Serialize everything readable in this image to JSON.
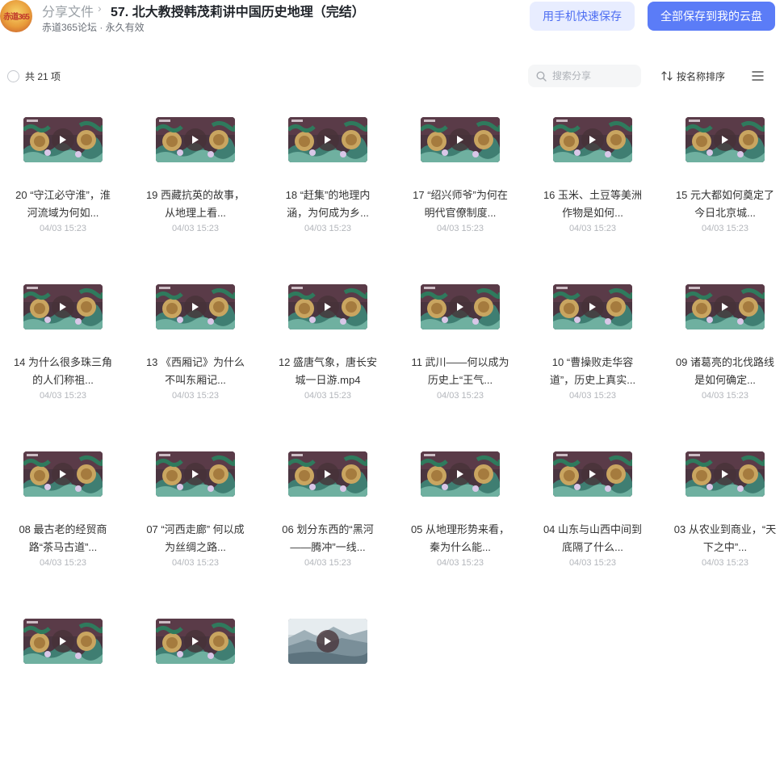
{
  "share": {
    "avatar_text": "赤道365",
    "breadcrumb_root": "分享文件",
    "breadcrumb_sep": "›",
    "title": "57. 北大教授韩茂莉讲中国历史地理（完结）",
    "sub_info": "赤道365论坛 · 永久有效"
  },
  "actions": {
    "phone_save": "用手机快速保存",
    "save_all": "全部保存到我的云盘"
  },
  "toolbar": {
    "item_count": "共 21 项",
    "search_placeholder": "搜索分享",
    "sort_label": "按名称排序"
  },
  "thumbnail_icon": "play-icon",
  "files": [
    {
      "name": "20 “守江必守淮”，淮河流域为何如...",
      "date": "04/03 15:23",
      "thumb": "art"
    },
    {
      "name": "19 西藏抗英的故事，从地理上看...",
      "date": "04/03 15:23",
      "thumb": "art"
    },
    {
      "name": "18 “赶集”的地理内涵，为何成为乡...",
      "date": "04/03 15:23",
      "thumb": "art"
    },
    {
      "name": "17 “绍兴师爷”为何在明代官僚制度...",
      "date": "04/03 15:23",
      "thumb": "art"
    },
    {
      "name": "16 玉米、土豆等美洲作物是如何...",
      "date": "04/03 15:23",
      "thumb": "art"
    },
    {
      "name": "15 元大都如何奠定了今日北京城...",
      "date": "04/03 15:23",
      "thumb": "art"
    },
    {
      "name": "14 为什么很多珠三角的人们称祖...",
      "date": "04/03 15:23",
      "thumb": "art"
    },
    {
      "name": "13 《西厢记》为什么不叫东厢记...",
      "date": "04/03 15:23",
      "thumb": "art"
    },
    {
      "name": "12 盛唐气象，唐长安城一日游.mp4",
      "date": "04/03 15:23",
      "thumb": "art"
    },
    {
      "name": "11 武川——何以成为历史上“王气...",
      "date": "04/03 15:23",
      "thumb": "art"
    },
    {
      "name": "10 “曹操败走华容道”，历史上真实...",
      "date": "04/03 15:23",
      "thumb": "art"
    },
    {
      "name": "09 诸葛亮的北伐路线是如何确定...",
      "date": "04/03 15:23",
      "thumb": "art"
    },
    {
      "name": "08 最古老的经贸商路“茶马古道”...",
      "date": "04/03 15:23",
      "thumb": "art"
    },
    {
      "name": "07 “河西走廊” 何以成为丝绸之路...",
      "date": "04/03 15:23",
      "thumb": "art"
    },
    {
      "name": "06 划分东西的“黑河——腾冲”一线...",
      "date": "04/03 15:23",
      "thumb": "art"
    },
    {
      "name": "05 从地理形势来看，秦为什么能...",
      "date": "04/03 15:23",
      "thumb": "art"
    },
    {
      "name": "04 山东与山西中间到底隔了什么...",
      "date": "04/03 15:23",
      "thumb": "art"
    },
    {
      "name": "03 从农业到商业，“天下之中”...",
      "date": "04/03 15:23",
      "thumb": "art"
    },
    {
      "name": "",
      "date": "",
      "thumb": "art"
    },
    {
      "name": "",
      "date": "",
      "thumb": "art"
    },
    {
      "name": "",
      "date": "",
      "thumb": "snow"
    }
  ],
  "colors": {
    "primary": "#5b7cf7",
    "primary_light": "#e8edff",
    "date_gray": "#b3b6bb"
  }
}
